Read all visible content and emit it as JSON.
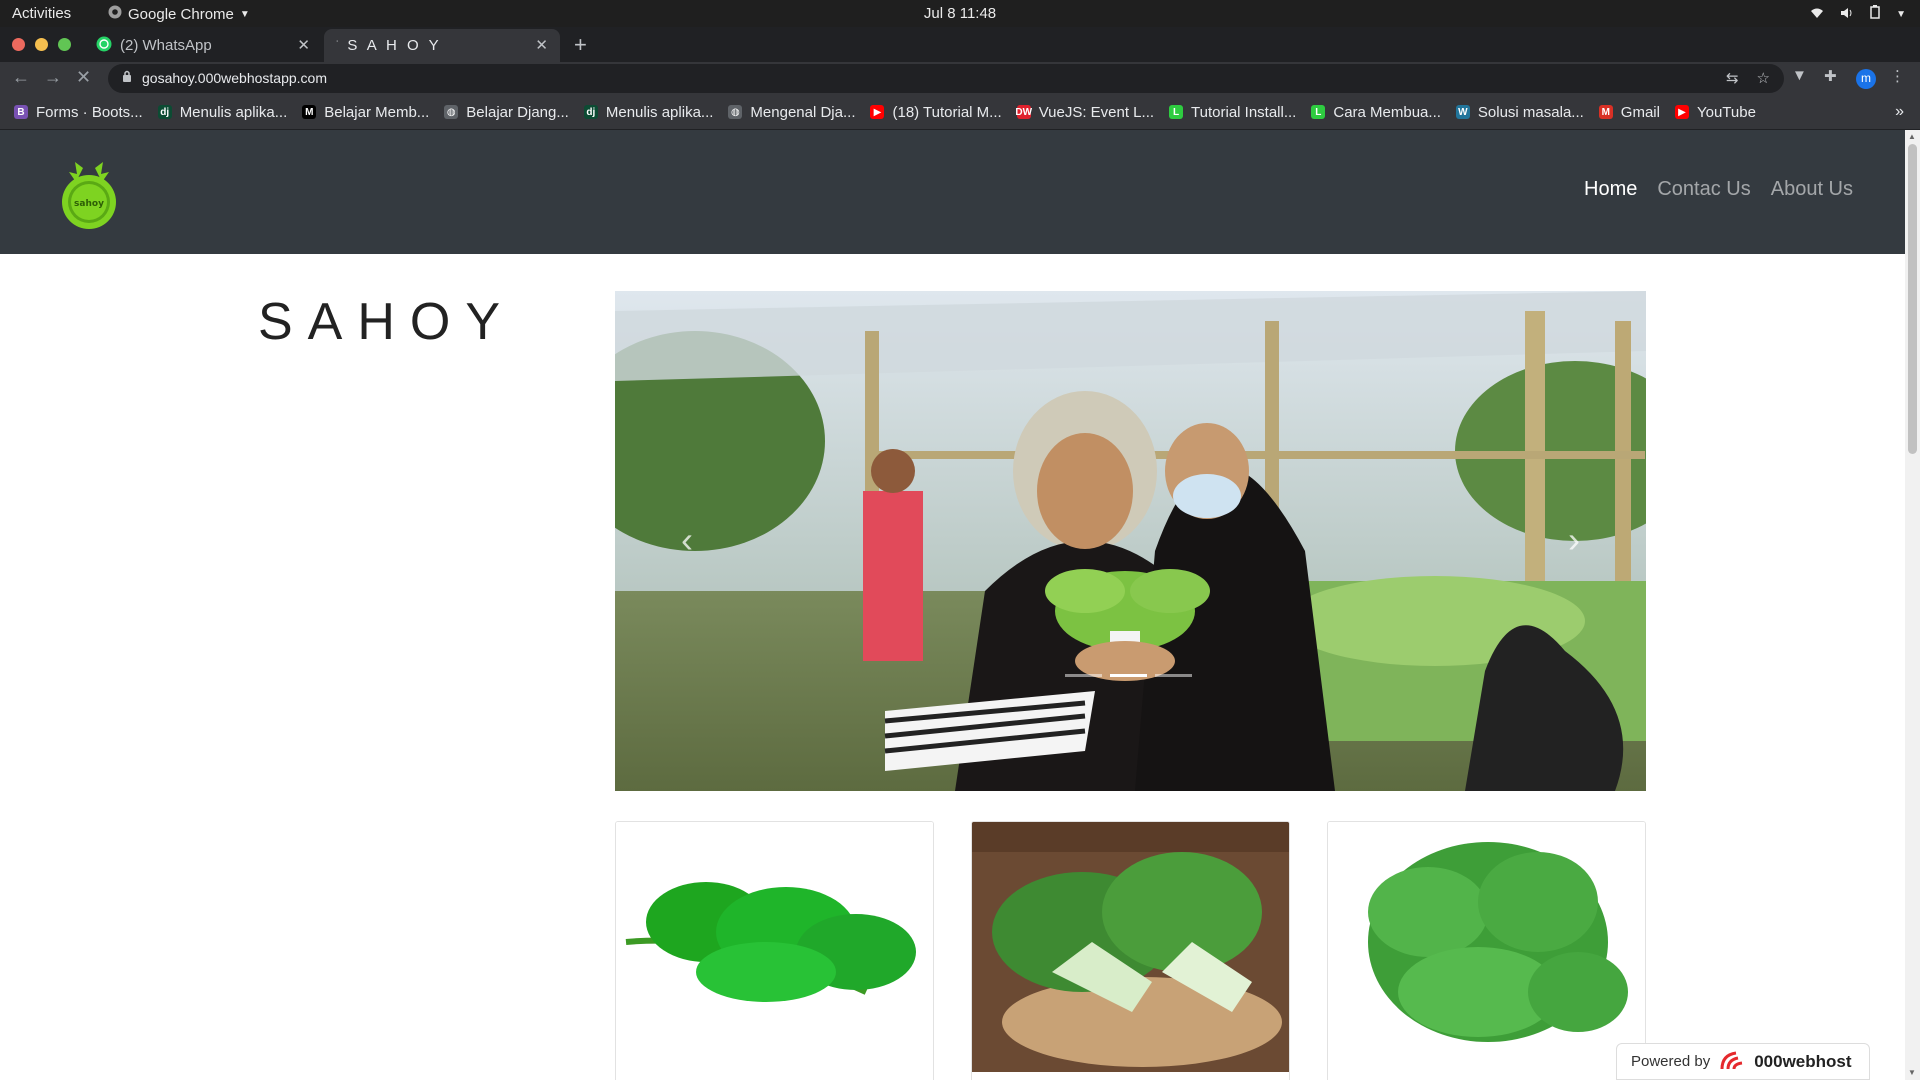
{
  "system": {
    "activities": "Activities",
    "app_name": "Google Chrome",
    "clock": "Jul 8  11:48"
  },
  "browser": {
    "tabs": [
      {
        "title": "(2) WhatsApp",
        "active": false
      },
      {
        "title": "S A H O Y",
        "active": true
      }
    ],
    "url": "gosahoy.000webhostapp.com",
    "profile_initial": "m",
    "bookmarks": [
      {
        "label": "Forms · Boots...",
        "icon": "bootstrap-icon",
        "color": "#7952b3",
        "glyph": "B"
      },
      {
        "label": "Menulis aplika...",
        "icon": "django-icon",
        "color": "#0c4b33",
        "glyph": "dj"
      },
      {
        "label": "Belajar Memb...",
        "icon": "medium-icon",
        "color": "#000000",
        "glyph": "M"
      },
      {
        "label": "Belajar Djang...",
        "icon": "globe-icon",
        "color": "#5f6368",
        "glyph": "◍"
      },
      {
        "label": "Menulis aplika...",
        "icon": "django-icon",
        "color": "#0c4b33",
        "glyph": "dj"
      },
      {
        "label": "Mengenal Dja...",
        "icon": "globe-icon",
        "color": "#5f6368",
        "glyph": "◍"
      },
      {
        "label": "(18) Tutorial M...",
        "icon": "youtube-icon",
        "color": "#ff0000",
        "glyph": "▶"
      },
      {
        "label": "VueJS: Event L...",
        "icon": "dw-icon",
        "color": "#e0202c",
        "glyph": "DW"
      },
      {
        "label": "Tutorial Install...",
        "icon": "leaf-icon",
        "color": "#2ecc40",
        "glyph": "L"
      },
      {
        "label": "Cara Membua...",
        "icon": "leaf-icon",
        "color": "#2ecc40",
        "glyph": "L"
      },
      {
        "label": "Solusi masala...",
        "icon": "wordpress-icon",
        "color": "#21759b",
        "glyph": "W"
      },
      {
        "label": "Gmail",
        "icon": "gmail-icon",
        "color": "#d93025",
        "glyph": "M"
      },
      {
        "label": "YouTube",
        "icon": "youtube-icon",
        "color": "#ff0000",
        "glyph": "▶"
      }
    ]
  },
  "site": {
    "nav": {
      "items": [
        {
          "label": "Home",
          "active": true
        },
        {
          "label": "Contac Us",
          "active": false
        },
        {
          "label": "About Us",
          "active": false
        }
      ]
    },
    "brand_title": "SAHOY",
    "carousel": {
      "slide_count": 3,
      "active_index": 1
    },
    "powered_by": {
      "prefix": "Powered by",
      "brand": "000webhost"
    }
  },
  "colors": {
    "navbar_bg": "#343a40",
    "logo_green": "#7ed321",
    "chrome_dark": "#202124"
  }
}
